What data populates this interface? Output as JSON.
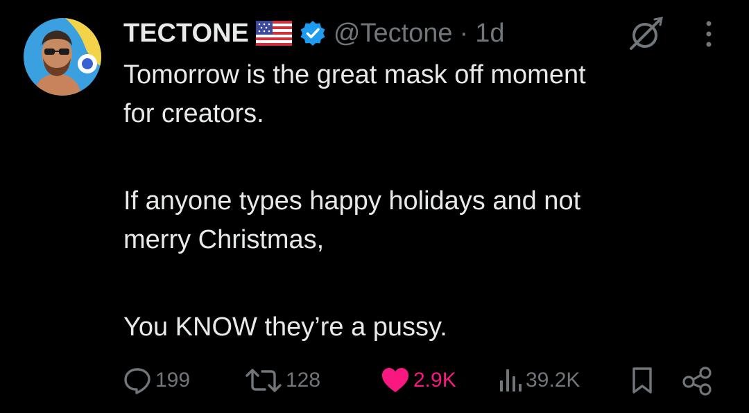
{
  "tweet": {
    "display_name": "TECTONE",
    "handle": "@Tectone",
    "separator": "·",
    "time": "1d",
    "paragraphs": [
      [
        "Tomorrow is the great mask off moment",
        "for creators."
      ],
      [
        "If anyone types happy holidays and not",
        "merry Christmas,"
      ],
      [
        "You KNOW they’re a pussy."
      ]
    ]
  },
  "icons": {
    "flag": "us-flag-emoji",
    "verified": "verified-badge-icon",
    "grok": "grok-icon",
    "more": "more-options-icon",
    "reply": "reply-icon",
    "repost": "repost-icon",
    "like": "heart-icon",
    "views": "views-icon",
    "bookmark": "bookmark-icon",
    "share": "share-icon"
  },
  "metrics": {
    "replies": "199",
    "reposts": "128",
    "likes": "2.9K",
    "views": "39.2K"
  },
  "colors": {
    "background": "#000000",
    "text": "#e7e9ea",
    "muted": "#71767b",
    "verified": "#1d9bf0",
    "like": "#f91880"
  }
}
